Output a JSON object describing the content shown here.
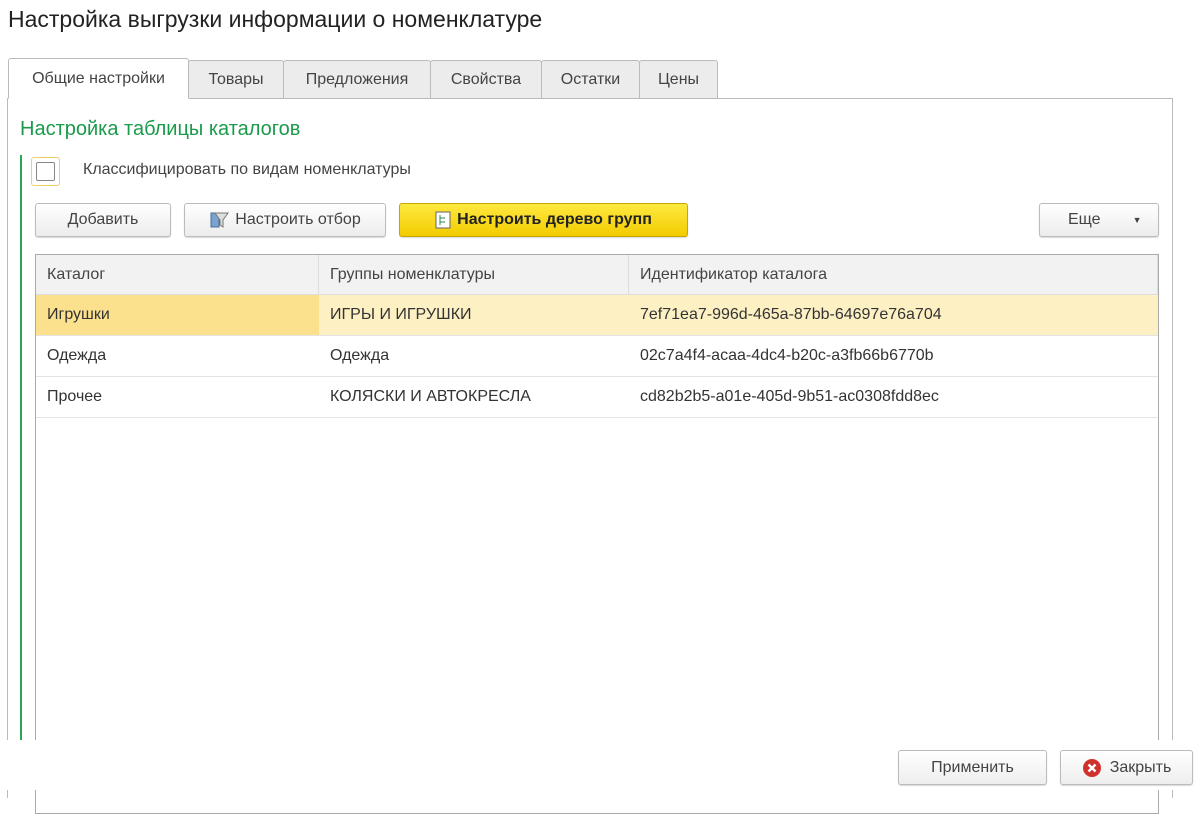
{
  "title": "Настройка выгрузки информации о номенклатуре",
  "tabs": [
    "Общие настройки",
    "Товары",
    "Предложения",
    "Свойства",
    "Остатки",
    "Цены"
  ],
  "group_title": "Настройка таблицы каталогов",
  "checkbox_label": "Классифицировать по видам номенклатуры",
  "checkbox_checked": false,
  "toolbar": {
    "add": "Добавить",
    "filter": "Настроить отбор",
    "tree": "Настроить дерево групп",
    "more": "Еще"
  },
  "table": {
    "columns": [
      "Каталог",
      "Группы номенклатуры",
      "Идентификатор каталога"
    ],
    "rows": [
      [
        "Игрушки",
        "ИГРЫ И ИГРУШКИ",
        "7ef71ea7-996d-465a-87bb-64697e76a704"
      ],
      [
        "Одежда",
        "Одежда",
        "02c7a4f4-acaa-4dc4-b20c-a3fb66b6770b"
      ],
      [
        "Прочее",
        "КОЛЯСКИ И АВТОКРЕСЛА",
        "cd82b2b5-a01e-405d-9b51-ac0308fdd8ec"
      ]
    ]
  },
  "footer": {
    "apply": "Применить",
    "close": "Закрыть"
  },
  "colors": {
    "accent_green": "#1a9a4a",
    "selected_row": "#fdf1c4",
    "primary_button": "#f2cc00"
  }
}
